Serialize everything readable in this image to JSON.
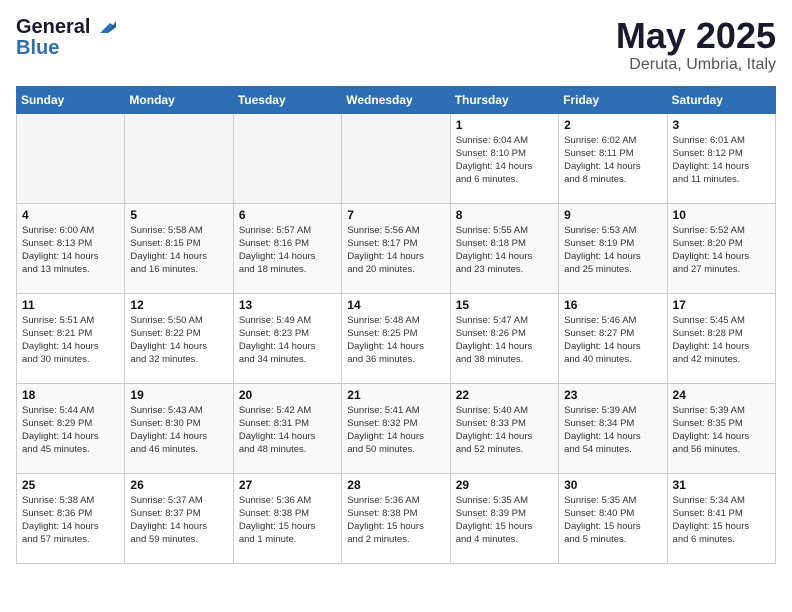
{
  "logo": {
    "general": "General",
    "blue": "Blue"
  },
  "title": "May 2025",
  "location": "Deruta, Umbria, Italy",
  "days_of_week": [
    "Sunday",
    "Monday",
    "Tuesday",
    "Wednesday",
    "Thursday",
    "Friday",
    "Saturday"
  ],
  "weeks": [
    [
      {
        "day": "",
        "info": ""
      },
      {
        "day": "",
        "info": ""
      },
      {
        "day": "",
        "info": ""
      },
      {
        "day": "",
        "info": ""
      },
      {
        "day": "1",
        "info": "Sunrise: 6:04 AM\nSunset: 8:10 PM\nDaylight: 14 hours\nand 6 minutes."
      },
      {
        "day": "2",
        "info": "Sunrise: 6:02 AM\nSunset: 8:11 PM\nDaylight: 14 hours\nand 8 minutes."
      },
      {
        "day": "3",
        "info": "Sunrise: 6:01 AM\nSunset: 8:12 PM\nDaylight: 14 hours\nand 11 minutes."
      }
    ],
    [
      {
        "day": "4",
        "info": "Sunrise: 6:00 AM\nSunset: 8:13 PM\nDaylight: 14 hours\nand 13 minutes."
      },
      {
        "day": "5",
        "info": "Sunrise: 5:58 AM\nSunset: 8:15 PM\nDaylight: 14 hours\nand 16 minutes."
      },
      {
        "day": "6",
        "info": "Sunrise: 5:57 AM\nSunset: 8:16 PM\nDaylight: 14 hours\nand 18 minutes."
      },
      {
        "day": "7",
        "info": "Sunrise: 5:56 AM\nSunset: 8:17 PM\nDaylight: 14 hours\nand 20 minutes."
      },
      {
        "day": "8",
        "info": "Sunrise: 5:55 AM\nSunset: 8:18 PM\nDaylight: 14 hours\nand 23 minutes."
      },
      {
        "day": "9",
        "info": "Sunrise: 5:53 AM\nSunset: 8:19 PM\nDaylight: 14 hours\nand 25 minutes."
      },
      {
        "day": "10",
        "info": "Sunrise: 5:52 AM\nSunset: 8:20 PM\nDaylight: 14 hours\nand 27 minutes."
      }
    ],
    [
      {
        "day": "11",
        "info": "Sunrise: 5:51 AM\nSunset: 8:21 PM\nDaylight: 14 hours\nand 30 minutes."
      },
      {
        "day": "12",
        "info": "Sunrise: 5:50 AM\nSunset: 8:22 PM\nDaylight: 14 hours\nand 32 minutes."
      },
      {
        "day": "13",
        "info": "Sunrise: 5:49 AM\nSunset: 8:23 PM\nDaylight: 14 hours\nand 34 minutes."
      },
      {
        "day": "14",
        "info": "Sunrise: 5:48 AM\nSunset: 8:25 PM\nDaylight: 14 hours\nand 36 minutes."
      },
      {
        "day": "15",
        "info": "Sunrise: 5:47 AM\nSunset: 8:26 PM\nDaylight: 14 hours\nand 38 minutes."
      },
      {
        "day": "16",
        "info": "Sunrise: 5:46 AM\nSunset: 8:27 PM\nDaylight: 14 hours\nand 40 minutes."
      },
      {
        "day": "17",
        "info": "Sunrise: 5:45 AM\nSunset: 8:28 PM\nDaylight: 14 hours\nand 42 minutes."
      }
    ],
    [
      {
        "day": "18",
        "info": "Sunrise: 5:44 AM\nSunset: 8:29 PM\nDaylight: 14 hours\nand 45 minutes."
      },
      {
        "day": "19",
        "info": "Sunrise: 5:43 AM\nSunset: 8:30 PM\nDaylight: 14 hours\nand 46 minutes."
      },
      {
        "day": "20",
        "info": "Sunrise: 5:42 AM\nSunset: 8:31 PM\nDaylight: 14 hours\nand 48 minutes."
      },
      {
        "day": "21",
        "info": "Sunrise: 5:41 AM\nSunset: 8:32 PM\nDaylight: 14 hours\nand 50 minutes."
      },
      {
        "day": "22",
        "info": "Sunrise: 5:40 AM\nSunset: 8:33 PM\nDaylight: 14 hours\nand 52 minutes."
      },
      {
        "day": "23",
        "info": "Sunrise: 5:39 AM\nSunset: 8:34 PM\nDaylight: 14 hours\nand 54 minutes."
      },
      {
        "day": "24",
        "info": "Sunrise: 5:39 AM\nSunset: 8:35 PM\nDaylight: 14 hours\nand 56 minutes."
      }
    ],
    [
      {
        "day": "25",
        "info": "Sunrise: 5:38 AM\nSunset: 8:36 PM\nDaylight: 14 hours\nand 57 minutes."
      },
      {
        "day": "26",
        "info": "Sunrise: 5:37 AM\nSunset: 8:37 PM\nDaylight: 14 hours\nand 59 minutes."
      },
      {
        "day": "27",
        "info": "Sunrise: 5:36 AM\nSunset: 8:38 PM\nDaylight: 15 hours\nand 1 minute."
      },
      {
        "day": "28",
        "info": "Sunrise: 5:36 AM\nSunset: 8:38 PM\nDaylight: 15 hours\nand 2 minutes."
      },
      {
        "day": "29",
        "info": "Sunrise: 5:35 AM\nSunset: 8:39 PM\nDaylight: 15 hours\nand 4 minutes."
      },
      {
        "day": "30",
        "info": "Sunrise: 5:35 AM\nSunset: 8:40 PM\nDaylight: 15 hours\nand 5 minutes."
      },
      {
        "day": "31",
        "info": "Sunrise: 5:34 AM\nSunset: 8:41 PM\nDaylight: 15 hours\nand 6 minutes."
      }
    ]
  ]
}
